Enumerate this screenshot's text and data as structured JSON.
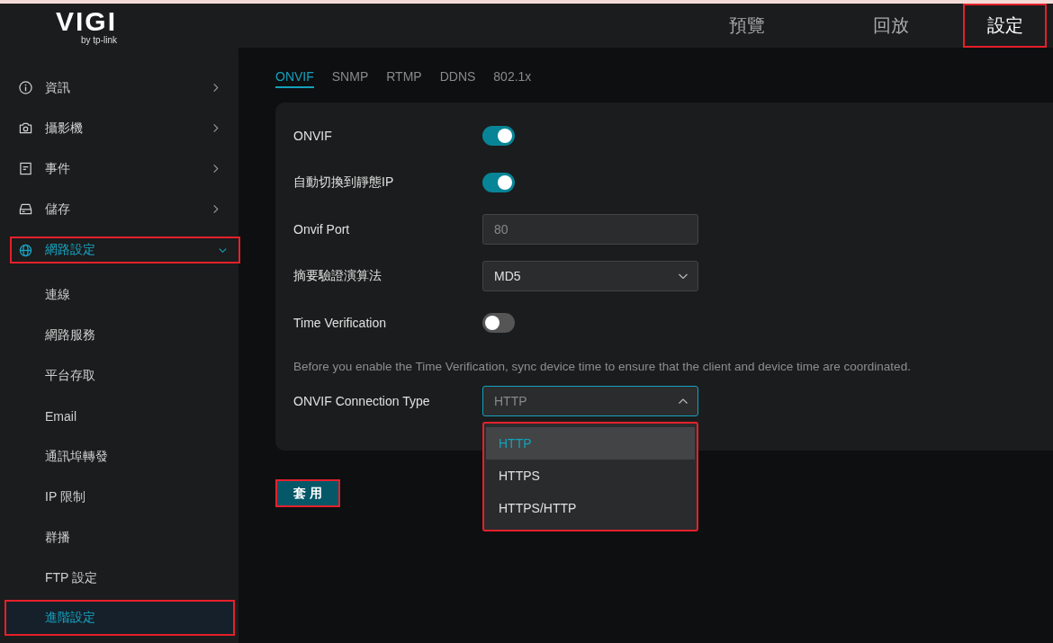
{
  "logo": {
    "name": "VIGI",
    "tagline": "by tp-link"
  },
  "top_nav": [
    {
      "label": "預覽",
      "selected": false,
      "highlighted": false
    },
    {
      "label": "回放",
      "selected": false,
      "highlighted": false
    },
    {
      "label": "設定",
      "selected": true,
      "highlighted": true
    }
  ],
  "sidebar": {
    "items": [
      {
        "kind": "info",
        "label": "資訊",
        "expanded": false,
        "highlighted": false
      },
      {
        "kind": "camera",
        "label": "攝影機",
        "expanded": false,
        "highlighted": false
      },
      {
        "kind": "event",
        "label": "事件",
        "expanded": false,
        "highlighted": false
      },
      {
        "kind": "storage",
        "label": "儲存",
        "expanded": false,
        "highlighted": false
      },
      {
        "kind": "network",
        "label": "網路設定",
        "expanded": true,
        "highlighted": true,
        "children": [
          {
            "label": "連線",
            "selected": false,
            "highlighted": false
          },
          {
            "label": "網路服務",
            "selected": false,
            "highlighted": false
          },
          {
            "label": "平台存取",
            "selected": false,
            "highlighted": false
          },
          {
            "label": "Email",
            "selected": false,
            "highlighted": false
          },
          {
            "label": "通訊埠轉發",
            "selected": false,
            "highlighted": false
          },
          {
            "label": "IP 限制",
            "selected": false,
            "highlighted": false
          },
          {
            "label": "群播",
            "selected": false,
            "highlighted": false
          },
          {
            "label": "FTP 設定",
            "selected": false,
            "highlighted": false
          },
          {
            "label": "進階設定",
            "selected": true,
            "highlighted": true
          }
        ]
      }
    ]
  },
  "tabs": [
    {
      "label": "ONVIF",
      "selected": true
    },
    {
      "label": "SNMP",
      "selected": false
    },
    {
      "label": "RTMP",
      "selected": false
    },
    {
      "label": "DDNS",
      "selected": false
    },
    {
      "label": "802.1x",
      "selected": false
    }
  ],
  "form": {
    "rows": [
      {
        "kind": "toggle",
        "label": "ONVIF",
        "on": true
      },
      {
        "kind": "toggle",
        "label": "自動切換到靜態IP",
        "on": true
      },
      {
        "kind": "input",
        "label": "Onvif Port",
        "value": "80",
        "disabled": true
      },
      {
        "kind": "select",
        "label": "摘要驗證演算法",
        "value": "MD5",
        "expanded": false
      },
      {
        "kind": "toggle",
        "label": "Time Verification",
        "on": false
      },
      {
        "kind": "note",
        "text": "Before you enable the Time Verification, sync device time to ensure that the client and device time are coordinated."
      },
      {
        "kind": "select",
        "label": "ONVIF Connection Type",
        "value": "HTTP",
        "expanded": true,
        "highlighted": true,
        "options": [
          {
            "label": "HTTP",
            "selected": true
          },
          {
            "label": "HTTPS",
            "selected": false
          },
          {
            "label": "HTTPS/HTTP",
            "selected": false
          }
        ]
      }
    ]
  },
  "apply_button": {
    "label": "套 用",
    "highlighted": true
  }
}
